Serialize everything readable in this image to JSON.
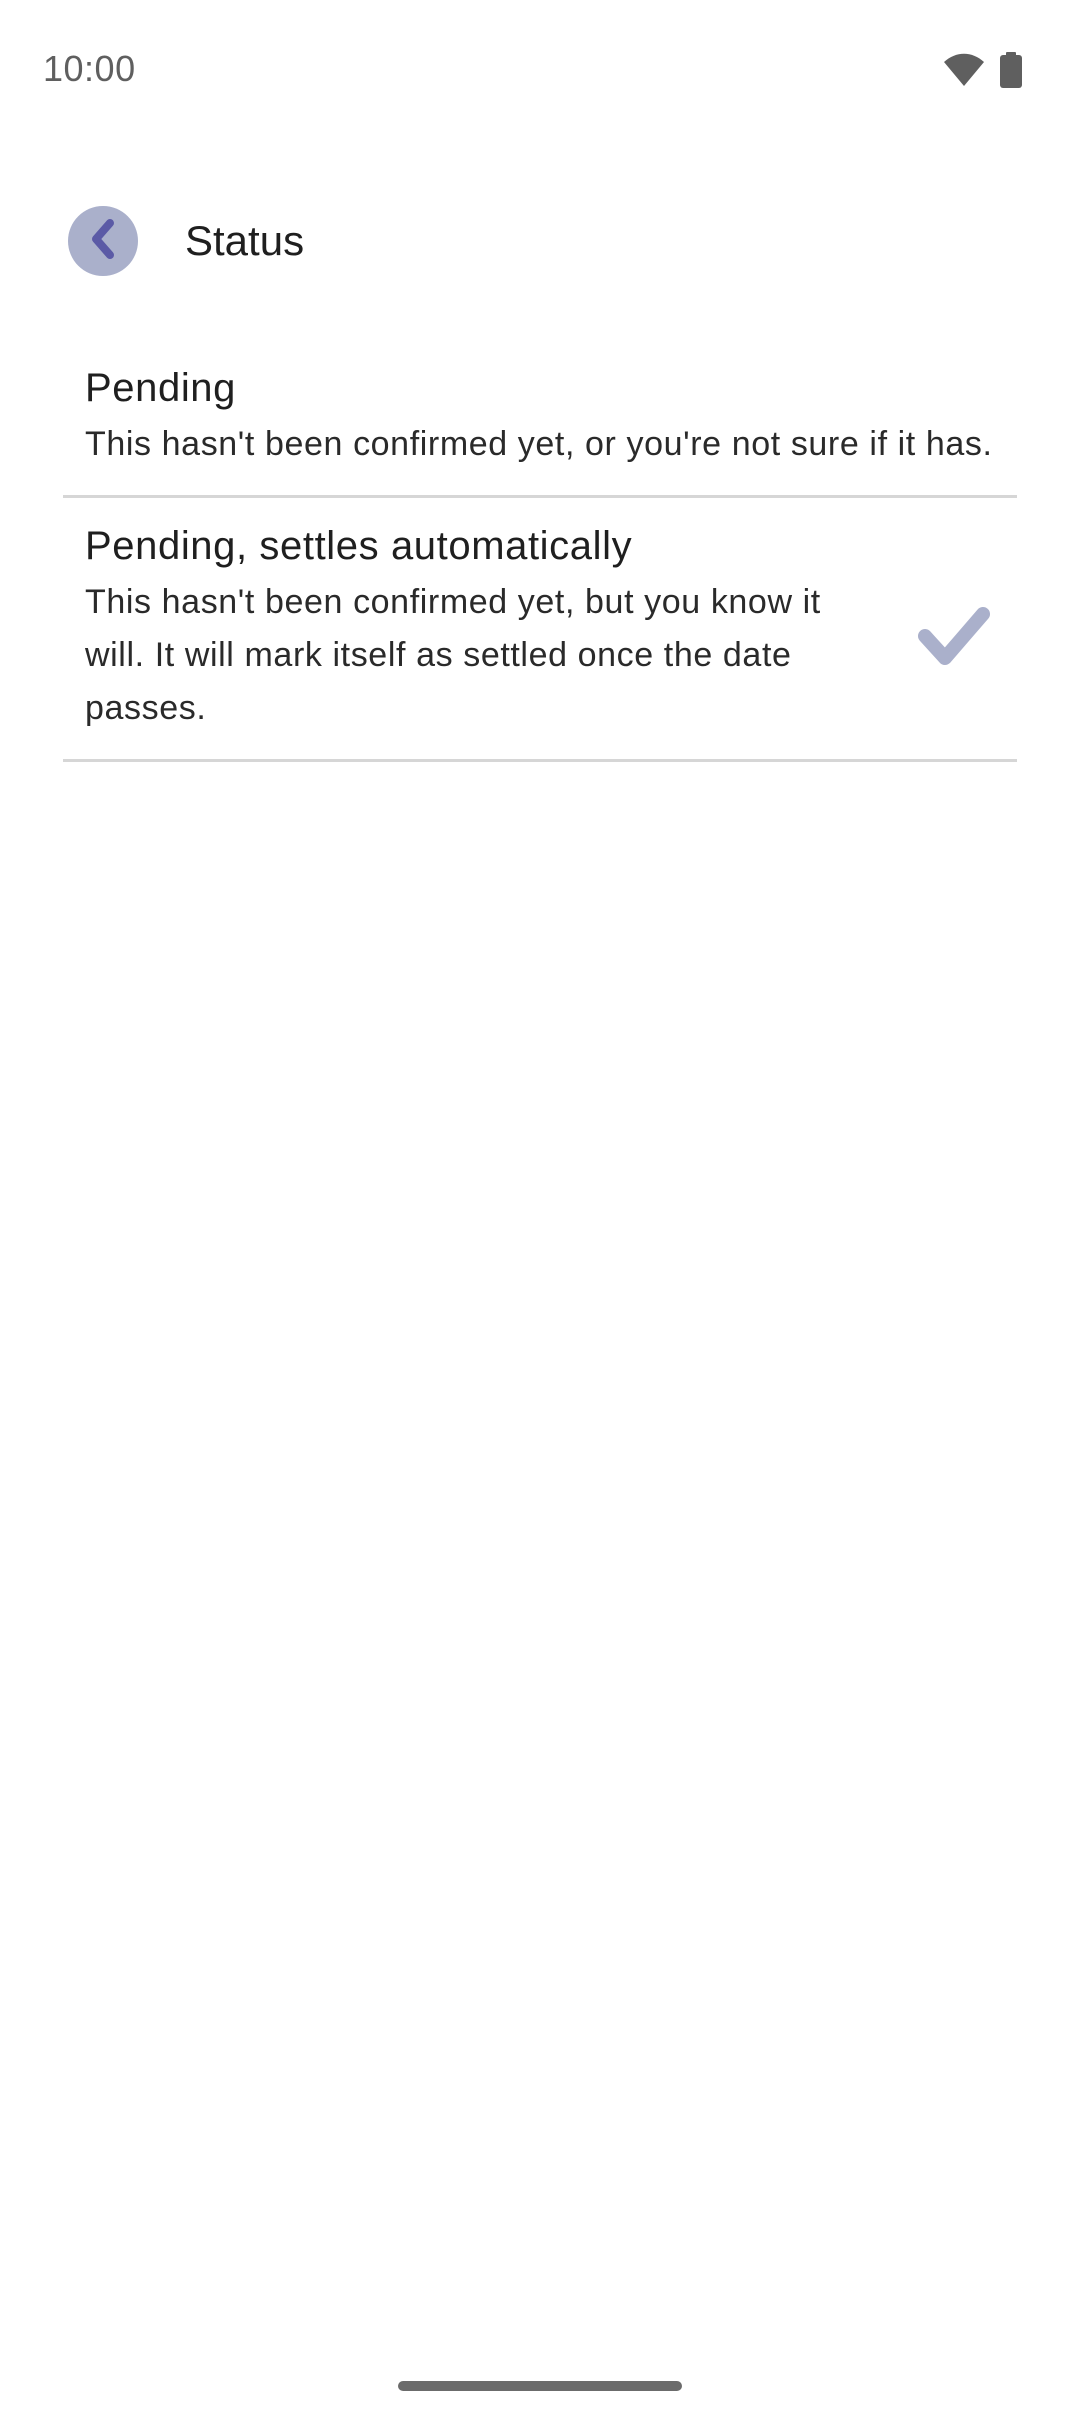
{
  "status_bar": {
    "time": "10:00",
    "icons": [
      "wifi-icon",
      "battery-icon"
    ]
  },
  "header": {
    "back_icon": "chevron-left-icon",
    "title": "Status"
  },
  "options": [
    {
      "title": "Pending",
      "description": "This hasn't been confirmed yet, or you're not sure if it has.",
      "selected": false
    },
    {
      "title": "Pending, settles automatically",
      "description": "This hasn't been confirmed yet, but you know it will. It will mark itself as settled once the date passes.",
      "selected": true
    }
  ],
  "colors": {
    "accent": "#5b5aa6",
    "back_button_bg": "#aab0cb",
    "check": "#aab0cb",
    "divider": "#d6d6d6"
  }
}
